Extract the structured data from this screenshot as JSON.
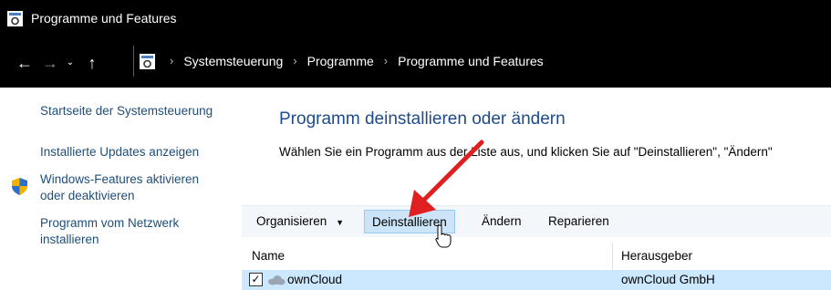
{
  "window": {
    "title": "Programme und Features"
  },
  "nav": {
    "back": "←",
    "forward": "→",
    "recent": "⌄",
    "up": "↑"
  },
  "breadcrumb": [
    "Systemsteuerung",
    "Programme",
    "Programme und Features"
  ],
  "sidebar": {
    "items": [
      {
        "label": "Startseite der Systemsteuerung"
      },
      {
        "label": "Installierte Updates anzeigen"
      },
      {
        "label_line1": "Windows-Features aktivieren",
        "label_line2": "oder deaktivieren"
      },
      {
        "label_line1": "Programm vom Netzwerk",
        "label_line2": "installieren"
      }
    ]
  },
  "main": {
    "heading": "Programm deinstallieren oder ändern",
    "description": "Wählen Sie ein Programm aus der Liste aus, und klicken Sie auf \"Deinstallieren\", \"Ändern\""
  },
  "toolbar": {
    "organize": "Organisieren",
    "organize_arrow": "▼",
    "uninstall": "Deinstallieren",
    "change": "Ändern",
    "repair": "Reparieren"
  },
  "table": {
    "columns": [
      "Name",
      "Herausgeber"
    ],
    "rows": [
      {
        "checked": "✓",
        "name": "ownCloud",
        "publisher": "ownCloud GmbH",
        "icon": "cloud-icon"
      }
    ]
  },
  "colors": {
    "link": "#1f4e79",
    "heading": "#1e4b8c",
    "selection": "#cce8ff",
    "active_button": "#cce4f7",
    "annotation_arrow": "#e02020"
  }
}
